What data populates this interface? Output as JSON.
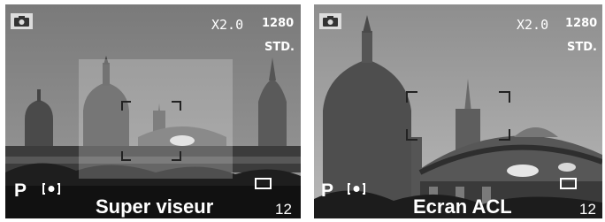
{
  "left_screen": {
    "zoom": "X2.0",
    "resolution": "1280",
    "quality": "STD.",
    "mode": "P",
    "caption": "Super viseur",
    "frames_remaining": "12",
    "icons": [
      "camera-icon",
      "metering-icon",
      "image-size-frame-icon"
    ]
  },
  "right_screen": {
    "zoom": "X2.0",
    "resolution": "1280",
    "quality": "STD.",
    "mode": "P",
    "caption": "Ecran ACL",
    "frames_remaining": "12",
    "icons": [
      "camera-icon",
      "metering-icon",
      "image-size-frame-icon"
    ]
  }
}
